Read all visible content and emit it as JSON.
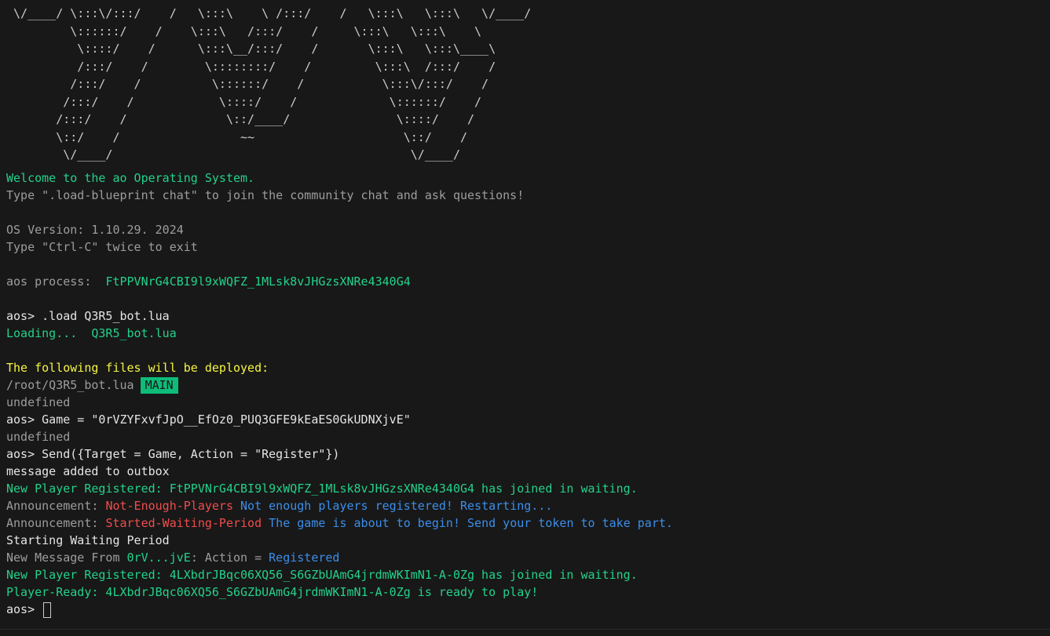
{
  "ascii_art": " \\/____/ \\:::\\/:::/    /   \\:::\\    \\ /:::/    /   \\:::\\   \\:::\\   \\/____/\n         \\::::::/    /    \\:::\\   /:::/    /     \\:::\\   \\:::\\    \\\n          \\::::/    /      \\:::\\__/:::/    /       \\:::\\   \\:::\\____\\\n          /:::/    /        \\::::::::/    /         \\:::\\  /:::/    /\n         /:::/    /          \\::::::/    /           \\:::\\/:::/    /\n        /:::/    /            \\::::/    /             \\::::::/    /\n       /:::/    /              \\::/____/               \\::::/    /\n       \\::/    /                 ~~                     \\::/    /\n        \\/____/                                          \\/____/",
  "lines": {
    "welcome": "Welcome to the ao Operating System.",
    "blueprint_hint": "Type \".load-blueprint chat\" to join the community chat and ask questions!",
    "os_version": "OS Version: 1.10.29. 2024",
    "exit_hint": "Type \"Ctrl-C\" twice to exit",
    "process_label": "aos process:  ",
    "process_id": "FtPPVNrG4CBI9l9xWQFZ_1MLsk8vJHGzsXNRe4340G4",
    "cmd_load": ".load Q3R5_bot.lua",
    "loading_label": "Loading...  ",
    "loading_file": "Q3R5_bot.lua",
    "deploy_header": "The following files will be deployed:",
    "deploy_path": "/root/Q3R5_bot.lua",
    "deploy_badge": "MAIN",
    "undefined_1": "undefined",
    "cmd_game": "Game = \"0rVZYFxvfJpO__EfOz0_PUQ3GFE9kEaES0GkUDNXjvE\"",
    "undefined_2": "undefined",
    "cmd_send": "Send({Target = Game, Action = \"Register\"})",
    "outbox_msg": "message added to outbox",
    "new_player_1": "New Player Registered: FtPPVNrG4CBI9l9xWQFZ_1MLsk8vJHGzsXNRe4340G4 has joined in waiting.",
    "announce_label": "Announcement: ",
    "announce_1_event": "Not-Enough-Players",
    "announce_1_msg": " Not enough players registered! Restarting...",
    "announce_2_event": "Started-Waiting-Period",
    "announce_2_msg": " The game is about to begin! Send your token to take part.",
    "waiting_period": "Starting Waiting Period",
    "new_msg_label": "New Message From ",
    "new_msg_from": "0rV...jvE",
    "new_msg_action": ": Action = ",
    "new_msg_value": "Registered",
    "new_player_2": "New Player Registered: 4LXbdrJBqc06XQ56_S6GZbUAmG4jrdmWKImN1-A-0Zg has joined in waiting.",
    "player_ready": "Player-Ready: 4LXbdrJBqc06XQ56_S6GZbUAmG4jrdmWKImN1-A-0Zg is ready to play!",
    "prompt": "aos> "
  },
  "colors": {
    "background": "#181818",
    "green": "#23d18b",
    "yellow": "#f5f543",
    "red": "#f14c4c",
    "blue": "#3b8eea",
    "badge_bg": "#0dbc79"
  }
}
